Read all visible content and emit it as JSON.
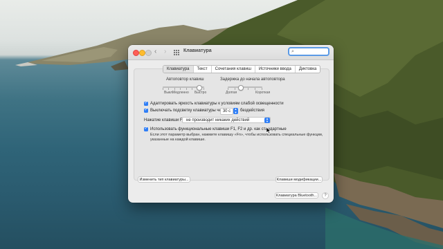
{
  "window": {
    "title": "Клавиатура",
    "search_placeholder": ""
  },
  "tabs": [
    {
      "label": "Клавиатура",
      "active": true
    },
    {
      "label": "Текст",
      "active": false
    },
    {
      "label": "Сочетания клавиш",
      "active": false
    },
    {
      "label": "Источники ввода",
      "active": false
    },
    {
      "label": "Диктовка",
      "active": false
    }
  ],
  "repeat": {
    "label": "Автоповтор клавиш",
    "min_label": "Выкл.",
    "mid_label": "Медленно",
    "max_label": "Быстро",
    "level": 0.86
  },
  "delay": {
    "label": "Задержка до начала автоповтора",
    "min_label": "Долгая",
    "max_label": "Короткая",
    "level": 0.35
  },
  "options": {
    "adjust_brightness": {
      "label": "Адаптировать яркость клавиатуры к условиям слабой освещенности",
      "checked": true
    },
    "backlight_off": {
      "label_before": "Выключать подсветку клавиатуры через",
      "value": "30 с",
      "label_after": "бездействия",
      "checked": true
    },
    "fn_key": {
      "label": "Нажатие клавиши Fn",
      "value": "не производит никаких действий"
    },
    "function_keys": {
      "label": "Использовать функциональные клавиши F1, F2 и др. как стандартные",
      "checked": true,
      "note_line1": "Если этот параметр выбран, нажмите клавишу «Fn», чтобы использовать специальные функции,",
      "note_line2": "указанные на каждой клавише."
    }
  },
  "buttons": {
    "change_type": "Изменить тип клавиатуры...",
    "modifier_keys": "Клавиши модификации...",
    "bluetooth": "Клавиатура Bluetooth...",
    "help": "?"
  },
  "colors": {
    "accent": "#2f7ef6",
    "close": "#fe5f57",
    "minimize": "#febc2e"
  }
}
